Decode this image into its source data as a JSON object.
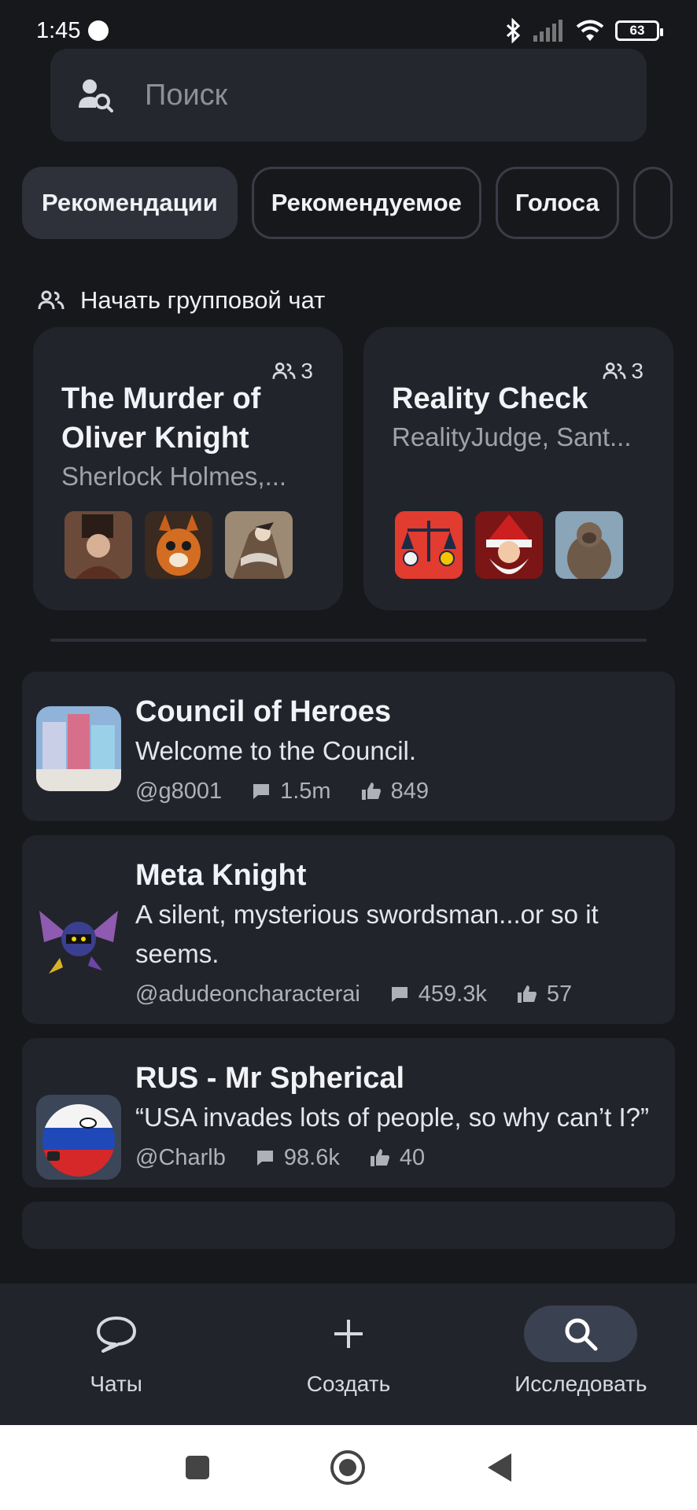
{
  "status": {
    "time": "1:45",
    "battery": "63"
  },
  "search": {
    "placeholder": "Поиск"
  },
  "chips": [
    "Рекомендации",
    "Рекомендуемое",
    "Голоса"
  ],
  "group_section": {
    "title": "Начать групповой чат",
    "cards": [
      {
        "title": "The Murder of Oliver Knight",
        "subtitle": "Sherlock Holmes,...",
        "count": "3"
      },
      {
        "title": "Reality Check",
        "subtitle": "RealityJudge, Sant...",
        "count": "3"
      }
    ]
  },
  "characters": [
    {
      "name": "Council of Heroes",
      "desc": "Welcome to the Council.",
      "author": "@g8001",
      "chats": "1.5m",
      "likes": "849"
    },
    {
      "name": "Meta Knight",
      "desc": "A silent, mysterious swordsman...or so it seems.",
      "author": "@adudeoncharacterai",
      "chats": "459.3k",
      "likes": "57"
    },
    {
      "name": "RUS - Mr Spherical",
      "desc": "“USA invades lots of people, so why can’t I?”",
      "author": "@Charlb",
      "chats": "98.6k",
      "likes": "40"
    }
  ],
  "bottom_nav": [
    {
      "label": "Чаты",
      "icon": "chat-bubble-icon"
    },
    {
      "label": "Создать",
      "icon": "plus-icon"
    },
    {
      "label": "Исследовать",
      "icon": "search-icon"
    }
  ],
  "active_nav": "Исследовать"
}
